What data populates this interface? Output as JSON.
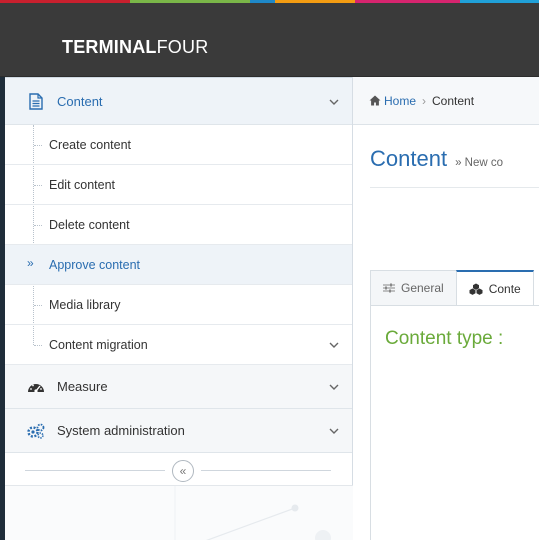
{
  "brand": {
    "name_bold": "TERMINAL",
    "name_light": "FOUR",
    "strip_colors": [
      "#c8202e",
      "#7ab648",
      "#1e88c8",
      "#f39c12",
      "#8e44ad",
      "#d6246e",
      "#20a0d8"
    ]
  },
  "sidebar": {
    "content_group": {
      "label": "Content",
      "icon": "document-icon"
    },
    "content_items": [
      {
        "label": "Create content"
      },
      {
        "label": "Edit content"
      },
      {
        "label": "Delete content"
      },
      {
        "label": "Approve content",
        "current": true
      },
      {
        "label": "Media library"
      },
      {
        "label": "Content migration",
        "has_submenu": true
      }
    ],
    "measure_group": {
      "label": "Measure",
      "icon": "gauge-icon"
    },
    "sysadmin_group": {
      "label": "System administration",
      "icon": "gears-icon"
    },
    "collapse_glyph": "«"
  },
  "breadcrumb": {
    "home_label": "Home",
    "separator": "›",
    "current": "Content"
  },
  "page": {
    "title": "Content",
    "subtitle": "» New co"
  },
  "tabs": [
    {
      "label": "General",
      "icon": "sliders-icon"
    },
    {
      "label": "Conte",
      "icon": "cubes-icon",
      "active": true
    }
  ],
  "content_type_label": "Content type :",
  "colors": {
    "accent_blue": "#2a6db0",
    "accent_green": "#6aaa3a",
    "topbar": "#3a3a3a"
  }
}
